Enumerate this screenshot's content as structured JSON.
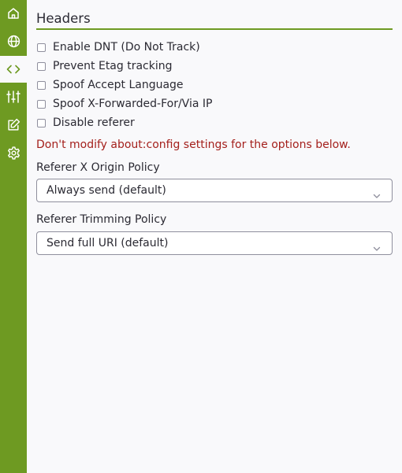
{
  "sidebar": {
    "items": [
      {
        "icon": "home-icon",
        "active": false
      },
      {
        "icon": "globe-icon",
        "active": false
      },
      {
        "icon": "code-icon",
        "active": true
      },
      {
        "icon": "sliders-icon",
        "active": false
      },
      {
        "icon": "edit-icon",
        "active": false
      },
      {
        "icon": "gear-icon",
        "active": false
      }
    ]
  },
  "section": {
    "title": "Headers"
  },
  "options": [
    {
      "label": "Enable DNT (Do Not Track)",
      "checked": false
    },
    {
      "label": "Prevent Etag tracking",
      "checked": false
    },
    {
      "label": "Spoof Accept Language",
      "checked": false
    },
    {
      "label": "Spoof X-Forwarded-For/Via IP",
      "checked": false
    },
    {
      "label": "Disable referer",
      "checked": false
    }
  ],
  "warning": "Don't modify about:config settings for the options below.",
  "referer_x_origin": {
    "label": "Referer X Origin Policy",
    "value": "Always send (default)"
  },
  "referer_trimming": {
    "label": "Referer Trimming Policy",
    "value": "Send full URI (default)"
  },
  "colors": {
    "accent": "#6e9a22",
    "warning": "#a4201c",
    "background": "#f9f9fb"
  }
}
